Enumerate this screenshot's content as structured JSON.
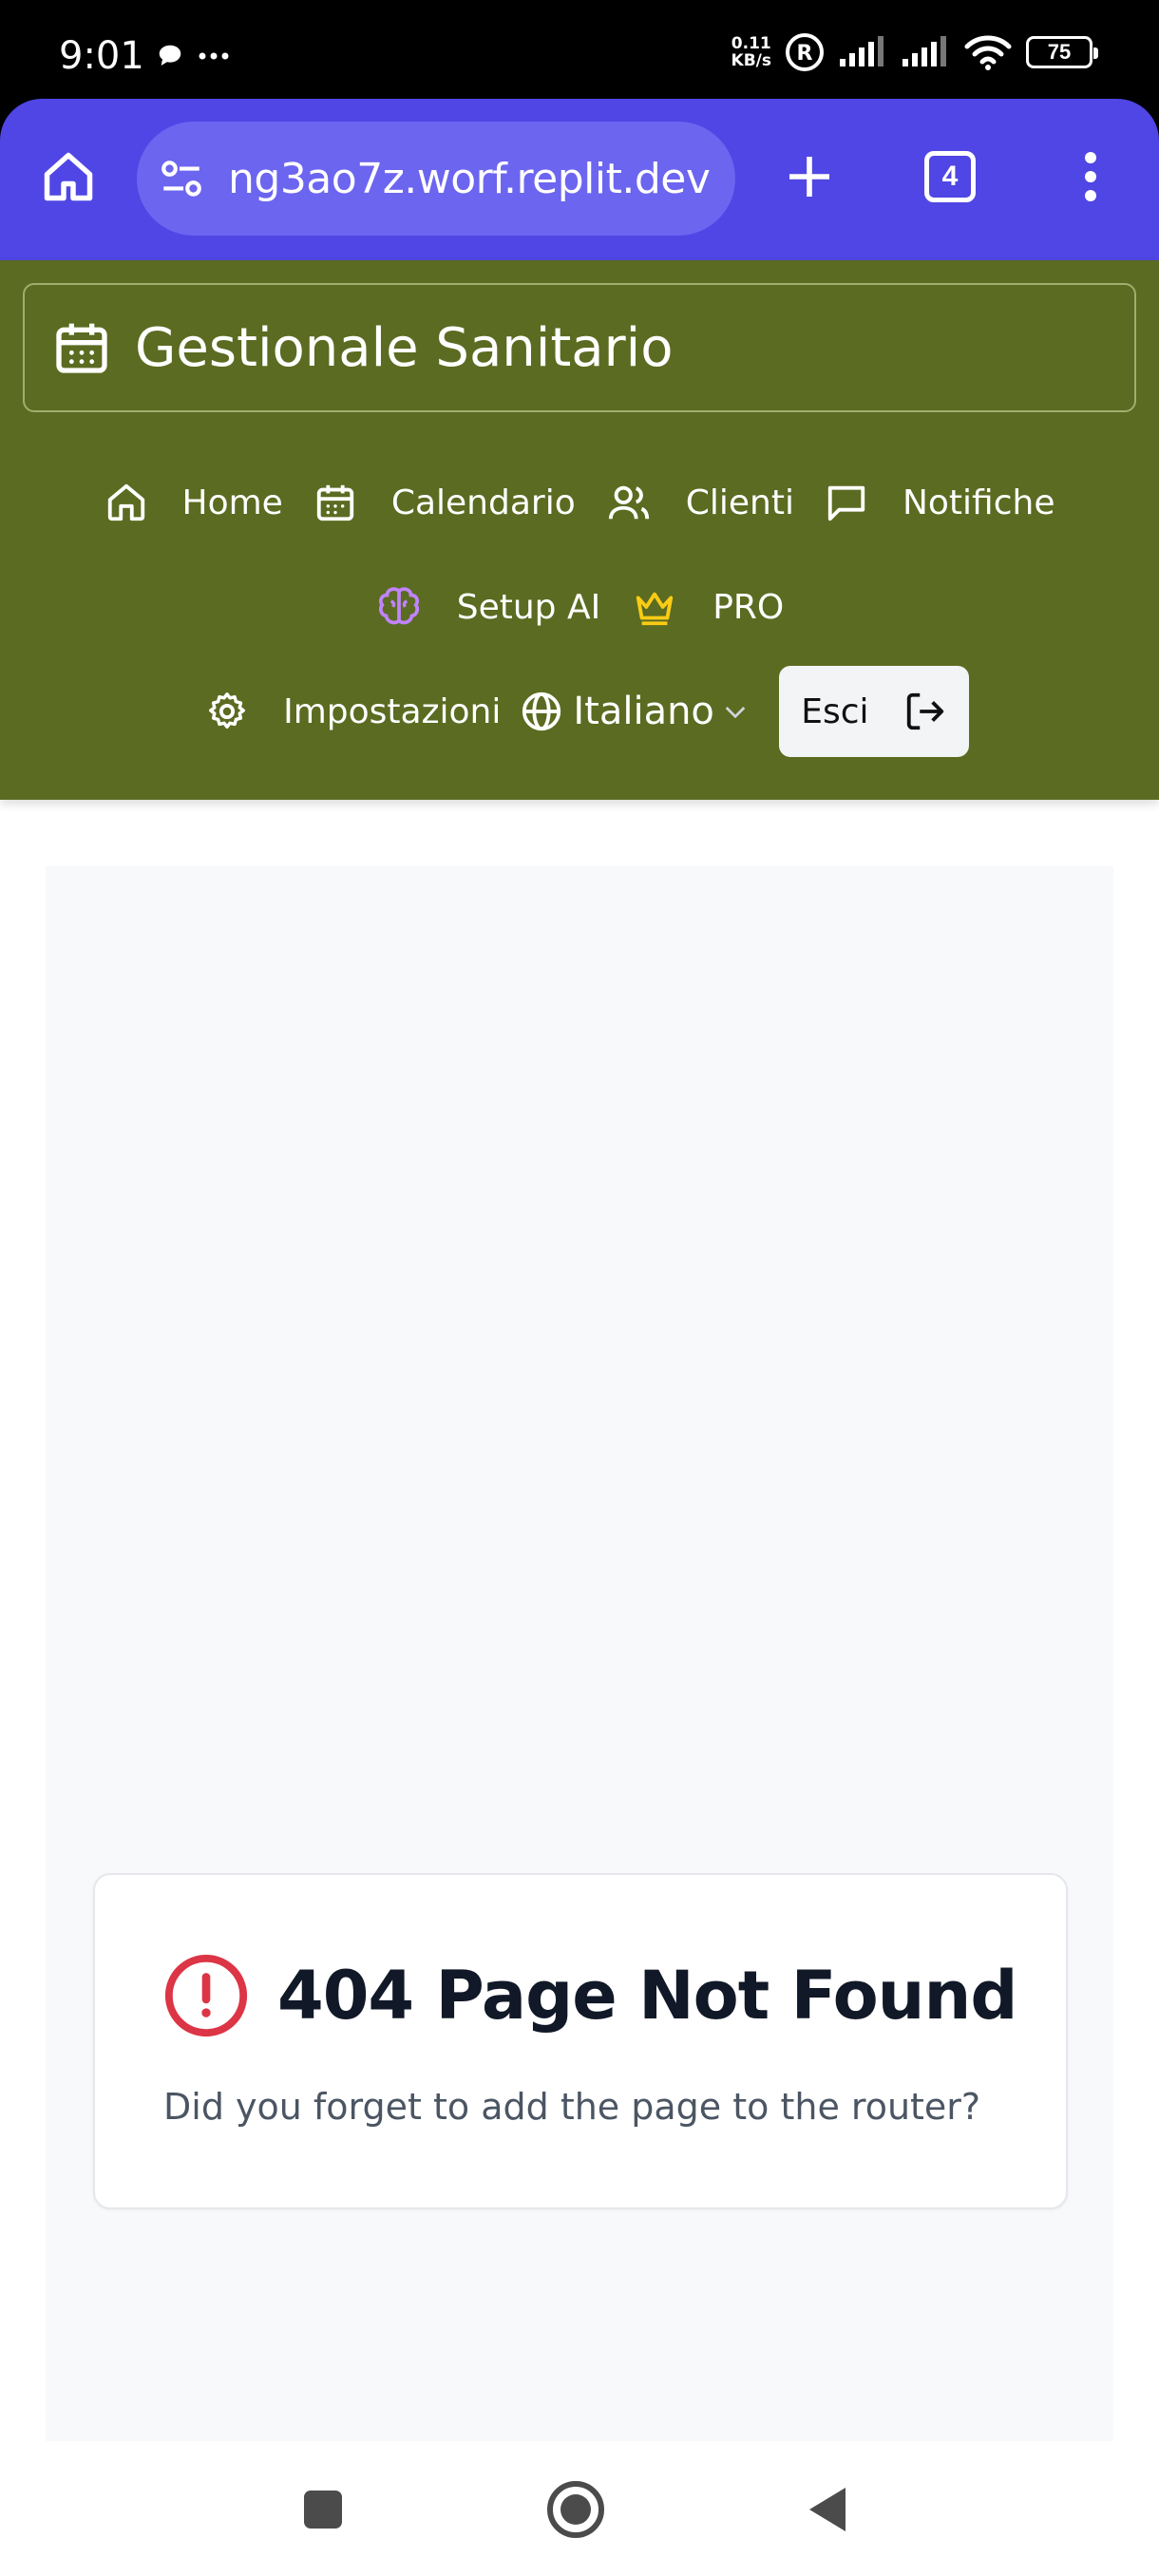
{
  "status_bar": {
    "time": "9:01",
    "net_speed_value": "0.11",
    "net_speed_unit": "KB/s",
    "battery": "75"
  },
  "browser": {
    "url": "ng3ao7z.worf.replit.dev",
    "tab_count": "4"
  },
  "app": {
    "brand_title": "Gestionale Sanitario",
    "nav": {
      "home": "Home",
      "calendar": "Calendario",
      "clients": "Clienti",
      "notifications": "Notifiche",
      "setup_ai": "Setup AI",
      "pro": "PRO",
      "settings": "Impostazioni",
      "language": "Italiano",
      "logout": "Esci"
    },
    "colors": {
      "header_bg": "#5b6b21",
      "browser_bg": "#4f46e5",
      "brain_icon": "#c084fc",
      "crown_icon": "#facc15",
      "error_icon": "#dc3545"
    }
  },
  "main": {
    "error_title": "404 Page Not Found",
    "error_description": "Did you forget to add the page to the router?"
  }
}
